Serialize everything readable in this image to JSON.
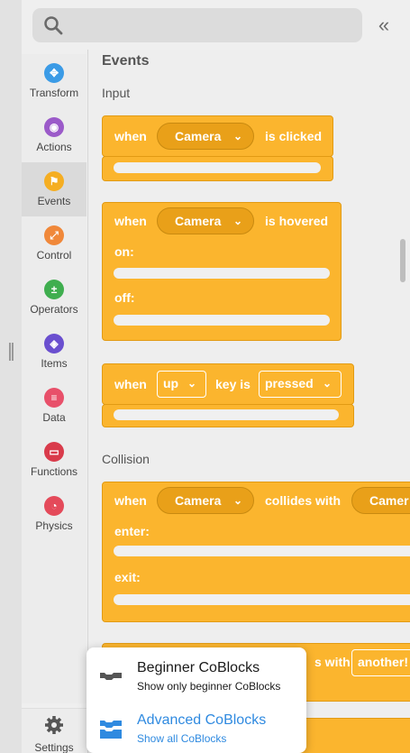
{
  "search": {
    "placeholder": ""
  },
  "collapse_label": "«",
  "categories": [
    {
      "label": "Transform",
      "color": "#3b9be6",
      "icon": "move-icon",
      "glyph": "✥"
    },
    {
      "label": "Actions",
      "color": "#9b5ac9",
      "icon": "eye-icon",
      "glyph": "◉"
    },
    {
      "label": "Events",
      "color": "#f5ae22",
      "icon": "flag-icon",
      "glyph": "⚑",
      "active": true
    },
    {
      "label": "Control",
      "color": "#f0883a",
      "icon": "arrows-icon",
      "glyph": "⤢"
    },
    {
      "label": "Operators",
      "color": "#3fae4f",
      "icon": "plus-minus-icon",
      "glyph": "±"
    },
    {
      "label": "Items",
      "color": "#6a4fcf",
      "icon": "cube-icon",
      "glyph": "◈"
    },
    {
      "label": "Data",
      "color": "#e8506a",
      "icon": "list-icon",
      "glyph": "≡"
    },
    {
      "label": "Functions",
      "color": "#d93b4b",
      "icon": "function-icon",
      "glyph": "▭"
    },
    {
      "label": "Physics",
      "color": "#e44a5a",
      "icon": "gauge-icon",
      "glyph": "◔"
    }
  ],
  "settings_label": "Settings",
  "panel": {
    "title": "Events",
    "section_input": "Input",
    "section_collision": "Collision",
    "block1": {
      "when": "when",
      "object": "Camera",
      "suffix": "is clicked"
    },
    "block2": {
      "when": "when",
      "object": "Camera",
      "suffix": "is hovered",
      "on": "on:",
      "off": "off:"
    },
    "block3": {
      "when": "when",
      "key": "up",
      "mid": "key is",
      "state": "pressed"
    },
    "block4": {
      "when": "when",
      "object": "Camera",
      "mid": "collides with",
      "object2": "Camer",
      "enter": "enter:",
      "exit": "exit:"
    },
    "block5": {
      "mid": "s with",
      "object2": "another!"
    }
  },
  "popover": {
    "beginner_title": "Beginner CoBlocks",
    "beginner_sub": "Show only beginner CoBlocks",
    "advanced_title": "Advanced CoBlocks",
    "advanced_sub": "Show all CoBlocks",
    "beginner_color": "#1a1a1a",
    "advanced_color": "#2f8ae0"
  },
  "chevron": "⌄"
}
